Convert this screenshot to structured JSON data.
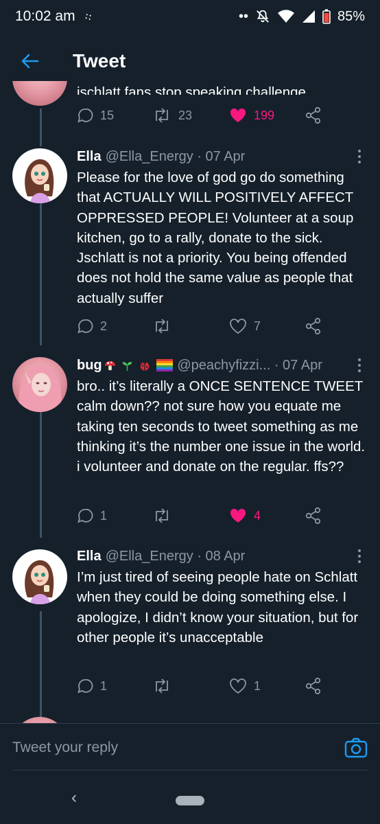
{
  "status_bar": {
    "time": "10:02 am",
    "battery": "85%"
  },
  "header": {
    "title": "Tweet"
  },
  "tweets": [
    {
      "text_fragment": "jschlatt fans stop speaking challenge",
      "replies": "15",
      "retweets": "23",
      "likes": "199",
      "liked": true
    },
    {
      "name": "Ella",
      "handle": "@Ella_Energy",
      "date": "07 Apr",
      "text": "Please for the love of god go do something that ACTUALLY WILL POSITIVELY AFFECT OPPRESSED PEOPLE! Volunteer at a soup kitchen, go to a rally, donate to the sick. Jschlatt is not a priority. You being offended does not hold the same value as people that actually suffer",
      "replies": "2",
      "retweets": "",
      "likes": "7",
      "liked": false
    },
    {
      "name": "bug",
      "handle": "@peachyfizzi...",
      "date": "07 Apr",
      "text": "bro.. it’s literally a ONCE SENTENCE TWEET calm down?? not sure how you equate me taking ten seconds to tweet something as me thinking it’s the number one issue in the world. i volunteer and donate on the regular. ffs??",
      "replies": "1",
      "retweets": "",
      "likes": "4",
      "liked": true
    },
    {
      "name": "Ella",
      "handle": "@Ella_Energy",
      "date": "08 Apr",
      "text": "I’m just tired of seeing people hate on Schlatt when they could be doing something else. I apologize, I didn’t know your situation, but for other people it’s unacceptable",
      "replies": "1",
      "retweets": "",
      "likes": "1",
      "liked": false
    }
  ],
  "reply_bar": {
    "placeholder": "Tweet your reply"
  },
  "colors": {
    "background": "#15202b",
    "accent": "#1d9bf0",
    "like": "#f91880",
    "muted": "#8b98a5"
  }
}
